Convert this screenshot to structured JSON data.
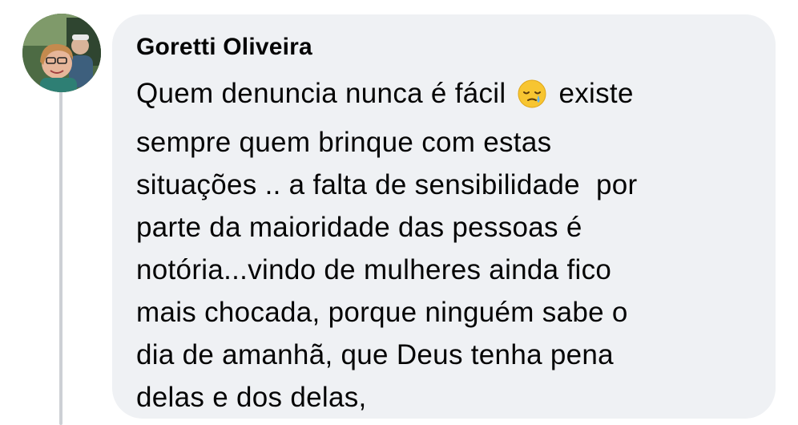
{
  "comment": {
    "author": "Goretti Oliveira",
    "lines": [
      {
        "before": "Quem denuncia nunca é fácil ",
        "emoji": "crying-face-emoji",
        "after": " existe"
      },
      {
        "text": "sempre quem brinque com estas"
      },
      {
        "text": "situações .. a falta de sensibilidade  por"
      },
      {
        "text": "parte da maioridade das pessoas é"
      },
      {
        "text": "notória...vindo de mulheres ainda fico"
      },
      {
        "text": "mais chocada, porque ninguém sabe o"
      },
      {
        "text": "dia de amanhã, que Deus tenha pena"
      },
      {
        "text": "delas e dos delas,"
      }
    ]
  },
  "colors": {
    "bubble": "#eff1f4",
    "text": "#050505",
    "thread_line": "#cdd0d5"
  }
}
